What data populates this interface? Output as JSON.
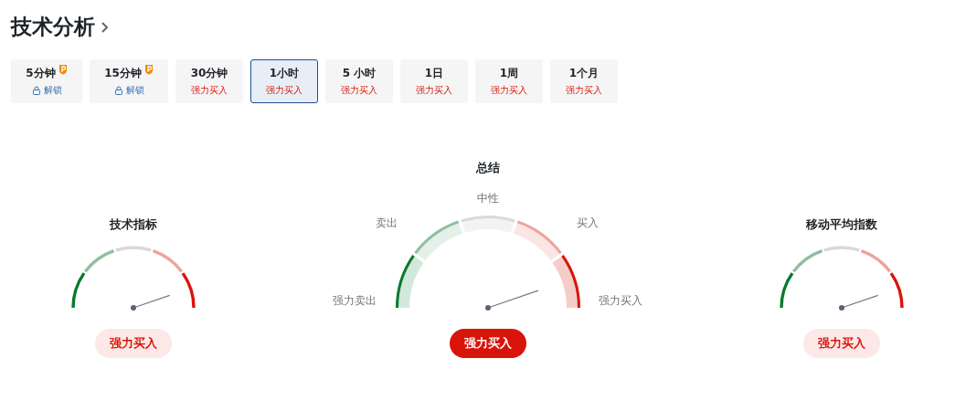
{
  "title": "技术分析",
  "timeframes": [
    {
      "label": "5分钟",
      "premium": true,
      "locked": true,
      "status": "解锁",
      "selected": false
    },
    {
      "label": "15分钟",
      "premium": true,
      "locked": true,
      "status": "解锁",
      "selected": false
    },
    {
      "label": "30分钟",
      "premium": false,
      "locked": false,
      "status": "强力买入",
      "selected": false
    },
    {
      "label": "1小时",
      "premium": false,
      "locked": false,
      "status": "强力买入",
      "selected": true
    },
    {
      "label": "5 小时",
      "premium": false,
      "locked": false,
      "status": "强力买入",
      "selected": false
    },
    {
      "label": "1日",
      "premium": false,
      "locked": false,
      "status": "强力买入",
      "selected": false
    },
    {
      "label": "1周",
      "premium": false,
      "locked": false,
      "status": "强力买入",
      "selected": false
    },
    {
      "label": "1个月",
      "premium": false,
      "locked": false,
      "status": "强力买入",
      "selected": false
    }
  ],
  "gauges": [
    {
      "kind": "compact",
      "title": "技术指标",
      "verdict": "强力买入"
    },
    {
      "kind": "detailed",
      "title": "总结",
      "zone_labels": [
        "强力卖出",
        "卖出",
        "中性",
        "买入",
        "强力买入"
      ],
      "verdict": "强力买入"
    },
    {
      "kind": "compact",
      "title": "移动平均指数",
      "verdict": "强力买入"
    }
  ]
}
